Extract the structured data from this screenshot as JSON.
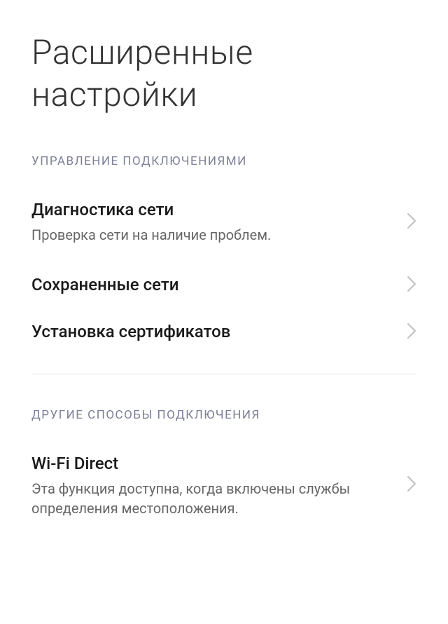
{
  "page": {
    "title": "Расширенные настройки"
  },
  "sections": [
    {
      "header": "УПРАВЛЕНИЕ ПОДКЛЮЧЕНИЯМИ",
      "items": [
        {
          "title": "Диагностика сети",
          "subtitle": "Проверка сети на наличие проблем."
        },
        {
          "title": "Сохраненные сети",
          "subtitle": null
        },
        {
          "title": "Установка сертификатов",
          "subtitle": null
        }
      ]
    },
    {
      "header": "ДРУГИЕ СПОСОБЫ ПОДКЛЮЧЕНИЯ",
      "items": [
        {
          "title": "Wi-Fi Direct",
          "subtitle": "Эта функция доступна, когда включены службы определения местоположения."
        }
      ]
    }
  ]
}
